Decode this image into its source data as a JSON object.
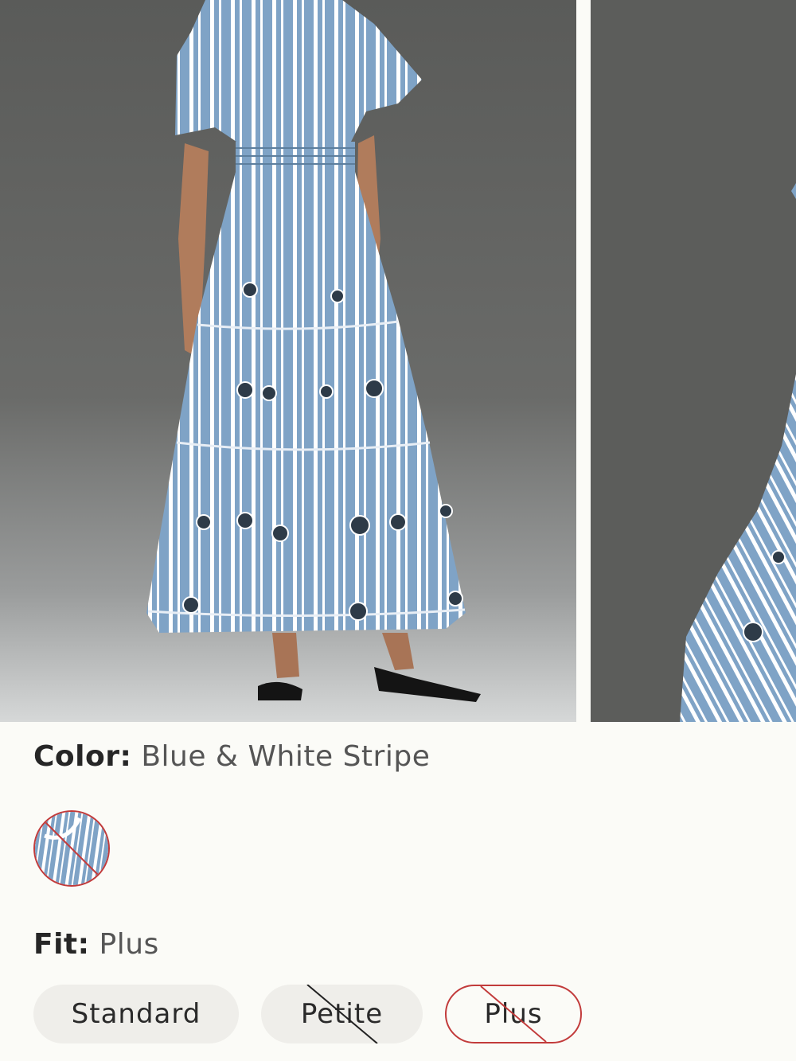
{
  "gallery": {
    "images": [
      {
        "alt": "model-wearing-dress-front",
        "accent": "#7fa3c6"
      },
      {
        "alt": "dress-detail-crop",
        "accent": "#7fa3c6"
      }
    ]
  },
  "color": {
    "label": "Color:",
    "value": "Blue & White Stripe",
    "swatches": [
      {
        "name": "Blue & White Stripe",
        "selected": true,
        "unavailable": true
      }
    ]
  },
  "fit": {
    "label": "Fit:",
    "value": "Plus",
    "options": [
      {
        "label": "Standard",
        "selected": false,
        "unavailable": false
      },
      {
        "label": "Petite",
        "selected": false,
        "unavailable": true
      },
      {
        "label": "Plus",
        "selected": true,
        "unavailable": true
      }
    ]
  },
  "colors": {
    "background": "#fbfbf7",
    "selected_outline": "#c23b3b",
    "chip": "#efeeea"
  }
}
